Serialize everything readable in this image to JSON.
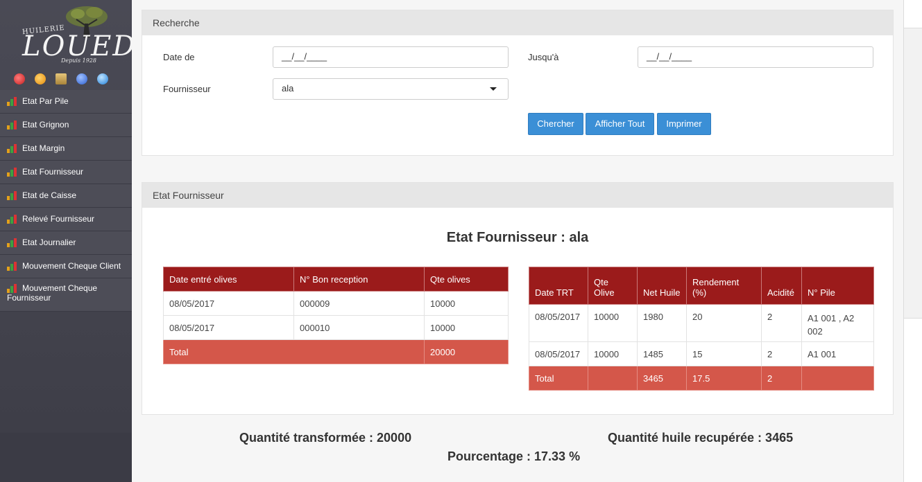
{
  "brand": {
    "name": "LOUED",
    "prefix": "HUILERIE",
    "since": "Depuis 1928"
  },
  "sidebar": {
    "quick_icons": [
      {
        "name": "people-icon",
        "color": "#e23b3b"
      },
      {
        "name": "coin-icon",
        "color": "#f2a51a"
      },
      {
        "name": "box-icon",
        "color": "#d8b35a"
      },
      {
        "name": "user-icon",
        "color": "#3a6fd8"
      },
      {
        "name": "globe-icon",
        "color": "#2f8fe0"
      }
    ],
    "items": [
      {
        "label": "Etat Par Pile"
      },
      {
        "label": "Etat Grignon"
      },
      {
        "label": "Etat Margin"
      },
      {
        "label": "Etat Fournisseur"
      },
      {
        "label": "Etat de Caisse"
      },
      {
        "label": "Relevé Fournisseur"
      },
      {
        "label": "Etat Journalier"
      },
      {
        "label": "Mouvement Cheque Client"
      },
      {
        "label": "Mouvement Cheque Fournisseur"
      }
    ]
  },
  "search": {
    "title": "Recherche",
    "date_from_label": "Date de",
    "date_from_value": "__/__/____",
    "date_to_label": "Jusqu'à",
    "date_to_value": "__/__/____",
    "supplier_label": "Fournisseur",
    "supplier_value": "ala",
    "search_button": "Chercher",
    "show_all_button": "Afficher Tout",
    "print_button": "Imprimer"
  },
  "report": {
    "panel_title": "Etat Fournisseur",
    "heading": "Etat Fournisseur : ala",
    "reception_table": {
      "headers": [
        "Date entré olives",
        "N° Bon reception",
        "Qte olives"
      ],
      "rows": [
        [
          "08/05/2017",
          "000009",
          "10000"
        ],
        [
          "08/05/2017",
          "000010",
          "10000"
        ]
      ],
      "total_label": "Total",
      "total_value": "20000"
    },
    "treatment_table": {
      "headers": [
        "Date TRT",
        "Qte Olive",
        "Net Huile",
        "Rendement (%)",
        "Acidité",
        "N° Pile"
      ],
      "rows": [
        [
          "08/05/2017",
          "10000",
          "1980",
          "20",
          "2",
          "A1 001 , A2 002"
        ],
        [
          "08/05/2017",
          "10000",
          "1485",
          "15",
          "2",
          "A1 001"
        ]
      ],
      "total": [
        "Total",
        "",
        "3465",
        "17.5",
        "2",
        ""
      ]
    }
  },
  "summary": {
    "quantity": "Quantité transformée : 20000",
    "oil": "Quantité huile recupérée : 3465",
    "percentage": "Pourcentage : 17.33 %"
  }
}
